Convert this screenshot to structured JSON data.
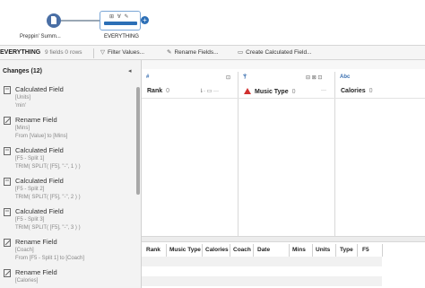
{
  "flow": {
    "input_label": "Preppin' Summ...",
    "step_label": "EVERYTHING",
    "step_icons": "⊞ ∀ ✎"
  },
  "toolbar": {
    "title": "EVERYTHING",
    "meta": "9 fields  0 rows",
    "filter_label": "Filter Values...",
    "rename_label": "Rename Fields...",
    "calc_label": "Create Calculated Field..."
  },
  "changes": {
    "title": "Changes (12)",
    "items": [
      {
        "type": "Calculated Field",
        "d1": "[Units]",
        "d2": "'min'",
        "icon": "calc-icon"
      },
      {
        "type": "Rename Field",
        "d1": "[Mins]",
        "d2": "From [Value] to [Mins]",
        "icon": "rename-icon"
      },
      {
        "type": "Calculated Field",
        "d1": "[F5 - Split 1]",
        "d2": "TRIM( SPLIT( [F5], \"-\", 1 ) )",
        "icon": "calc-icon"
      },
      {
        "type": "Calculated Field",
        "d1": "[F5 - Split 2]",
        "d2": "TRIM( SPLIT( [F5], \"-\", 2 ) )",
        "icon": "calc-icon"
      },
      {
        "type": "Calculated Field",
        "d1": "[F5 - Split 3]",
        "d2": "TRIM( SPLIT( [F5], \"-\", 3 ) )",
        "icon": "calc-icon"
      },
      {
        "type": "Rename Field",
        "d1": "[Coach]",
        "d2": "From [F5 - Split 1] to [Coach]",
        "icon": "rename-icon"
      },
      {
        "type": "Rename Field",
        "d1": "[Calories]",
        "d2": "",
        "icon": "rename-icon"
      }
    ]
  },
  "profile": {
    "rowlabel": "",
    "cards": [
      {
        "top": "#",
        "name": "Rank",
        "count": "0"
      },
      {
        "top": "Abc",
        "name": "Music Type",
        "count": "0",
        "warning": true
      },
      {
        "top": "Abc",
        "name": "Calories",
        "count": "0"
      }
    ]
  },
  "grid": {
    "columns": [
      "Rank",
      "Music Type",
      "Calories",
      "Coach",
      "Date",
      "Mins",
      "Units",
      "Type",
      "F5"
    ]
  }
}
